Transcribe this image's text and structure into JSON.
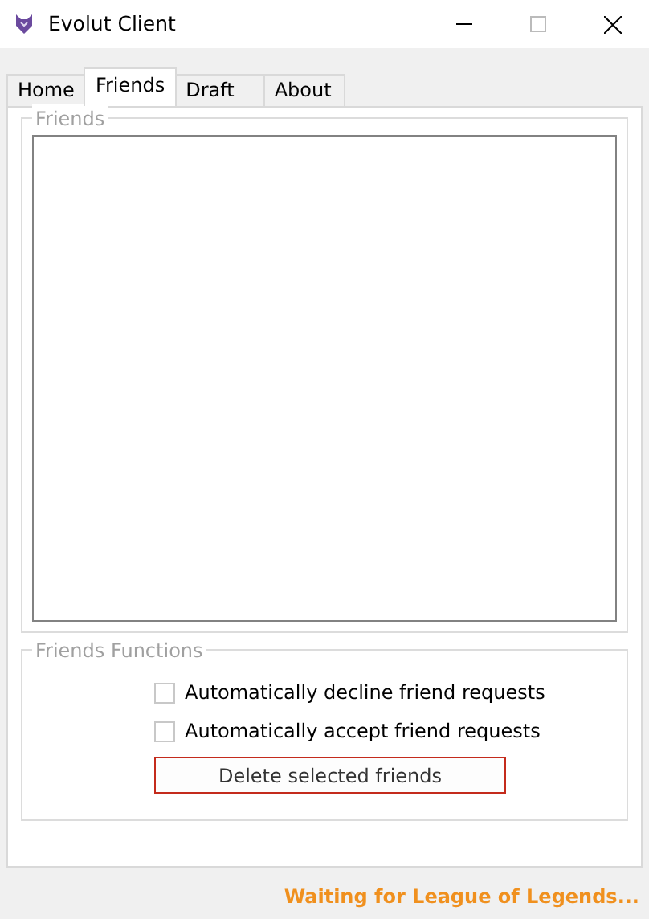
{
  "window": {
    "title": "Evolut Client"
  },
  "tabs": [
    {
      "label": "Home",
      "selected": false
    },
    {
      "label": "Friends",
      "selected": true
    },
    {
      "label": "Draft",
      "selected": false
    },
    {
      "label": "About",
      "selected": false
    }
  ],
  "friends_group": {
    "title": "Friends"
  },
  "functions_group": {
    "title": "Friends Functions",
    "options": [
      {
        "label": "Automatically decline friend requests",
        "checked": false
      },
      {
        "label": "Automatically accept friend requests",
        "checked": false
      }
    ],
    "button": "Delete selected friends"
  },
  "status_bar": "Waiting for League of Legends..."
}
